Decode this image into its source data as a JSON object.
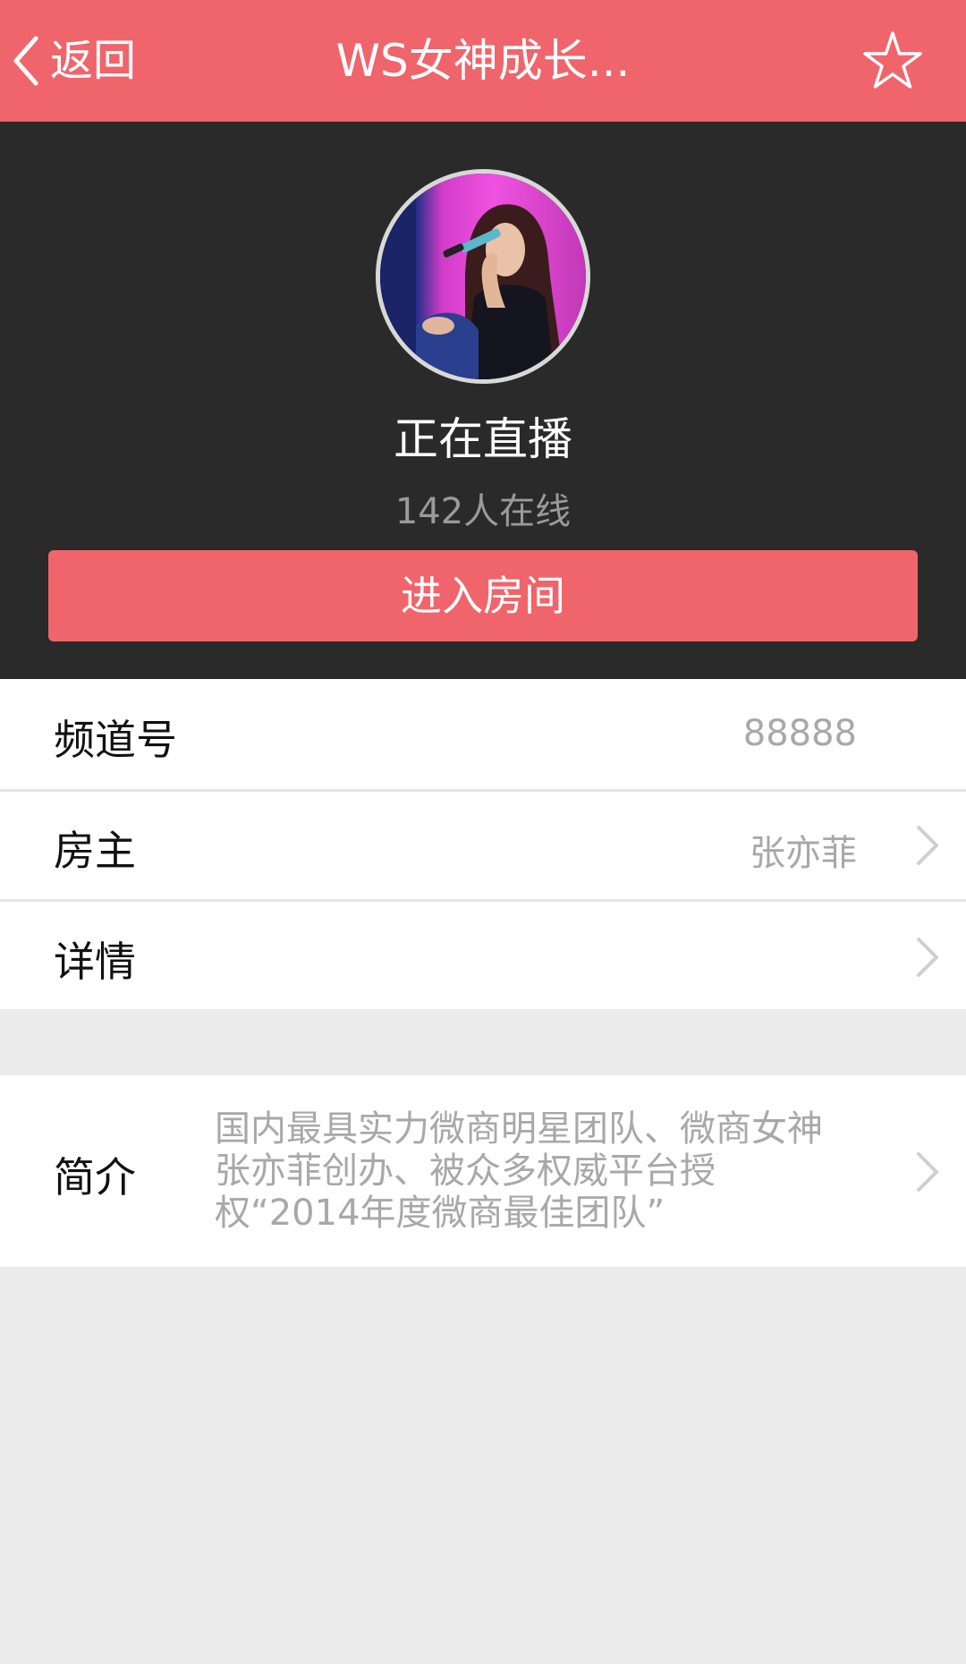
{
  "header": {
    "back_label": "返回",
    "title": "WS女神成长...",
    "icons": {
      "back": "chevron-left-icon",
      "favorite": "star-outline-icon"
    }
  },
  "hero": {
    "avatar_icon": "streamer-avatar",
    "status": "正在直播",
    "online": "142人在线",
    "enter_button": "进入房间"
  },
  "info": {
    "channel_label": "频道号",
    "channel_value": "88888",
    "owner_label": "房主",
    "owner_value": "张亦菲",
    "details_label": "详情"
  },
  "intro": {
    "label": "简介",
    "lines": [
      "国内最具实力微商明星团队、微商女神",
      "张亦菲创办、被众多权威平台授",
      "权“2014年度微商最佳团队”"
    ]
  },
  "colors": {
    "accent": "#ef656b",
    "hero_bg": "#2a2a2a",
    "page_bg": "#ececec",
    "secondary_text": "#a8a8a8"
  }
}
